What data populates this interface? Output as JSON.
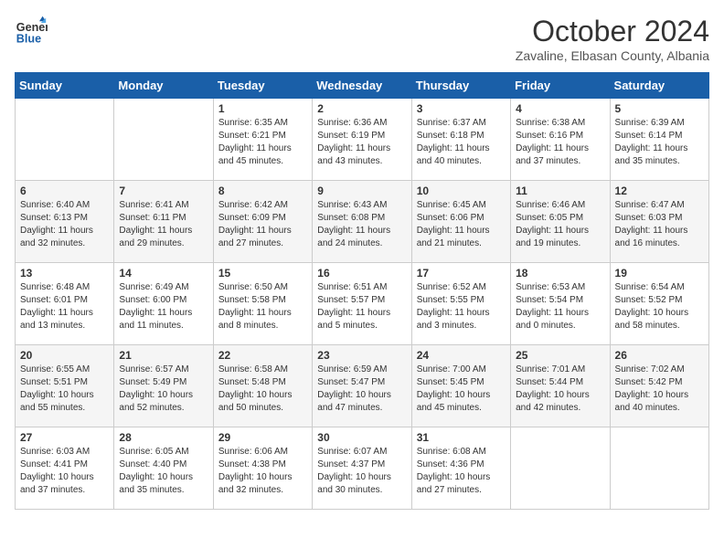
{
  "header": {
    "logo_line1": "General",
    "logo_line2": "Blue",
    "month_title": "October 2024",
    "subtitle": "Zavaline, Elbasan County, Albania"
  },
  "days_of_week": [
    "Sunday",
    "Monday",
    "Tuesday",
    "Wednesday",
    "Thursday",
    "Friday",
    "Saturday"
  ],
  "weeks": [
    [
      {
        "num": "",
        "sunrise": "",
        "sunset": "",
        "daylight": ""
      },
      {
        "num": "",
        "sunrise": "",
        "sunset": "",
        "daylight": ""
      },
      {
        "num": "1",
        "sunrise": "Sunrise: 6:35 AM",
        "sunset": "Sunset: 6:21 PM",
        "daylight": "Daylight: 11 hours and 45 minutes."
      },
      {
        "num": "2",
        "sunrise": "Sunrise: 6:36 AM",
        "sunset": "Sunset: 6:19 PM",
        "daylight": "Daylight: 11 hours and 43 minutes."
      },
      {
        "num": "3",
        "sunrise": "Sunrise: 6:37 AM",
        "sunset": "Sunset: 6:18 PM",
        "daylight": "Daylight: 11 hours and 40 minutes."
      },
      {
        "num": "4",
        "sunrise": "Sunrise: 6:38 AM",
        "sunset": "Sunset: 6:16 PM",
        "daylight": "Daylight: 11 hours and 37 minutes."
      },
      {
        "num": "5",
        "sunrise": "Sunrise: 6:39 AM",
        "sunset": "Sunset: 6:14 PM",
        "daylight": "Daylight: 11 hours and 35 minutes."
      }
    ],
    [
      {
        "num": "6",
        "sunrise": "Sunrise: 6:40 AM",
        "sunset": "Sunset: 6:13 PM",
        "daylight": "Daylight: 11 hours and 32 minutes."
      },
      {
        "num": "7",
        "sunrise": "Sunrise: 6:41 AM",
        "sunset": "Sunset: 6:11 PM",
        "daylight": "Daylight: 11 hours and 29 minutes."
      },
      {
        "num": "8",
        "sunrise": "Sunrise: 6:42 AM",
        "sunset": "Sunset: 6:09 PM",
        "daylight": "Daylight: 11 hours and 27 minutes."
      },
      {
        "num": "9",
        "sunrise": "Sunrise: 6:43 AM",
        "sunset": "Sunset: 6:08 PM",
        "daylight": "Daylight: 11 hours and 24 minutes."
      },
      {
        "num": "10",
        "sunrise": "Sunrise: 6:45 AM",
        "sunset": "Sunset: 6:06 PM",
        "daylight": "Daylight: 11 hours and 21 minutes."
      },
      {
        "num": "11",
        "sunrise": "Sunrise: 6:46 AM",
        "sunset": "Sunset: 6:05 PM",
        "daylight": "Daylight: 11 hours and 19 minutes."
      },
      {
        "num": "12",
        "sunrise": "Sunrise: 6:47 AM",
        "sunset": "Sunset: 6:03 PM",
        "daylight": "Daylight: 11 hours and 16 minutes."
      }
    ],
    [
      {
        "num": "13",
        "sunrise": "Sunrise: 6:48 AM",
        "sunset": "Sunset: 6:01 PM",
        "daylight": "Daylight: 11 hours and 13 minutes."
      },
      {
        "num": "14",
        "sunrise": "Sunrise: 6:49 AM",
        "sunset": "Sunset: 6:00 PM",
        "daylight": "Daylight: 11 hours and 11 minutes."
      },
      {
        "num": "15",
        "sunrise": "Sunrise: 6:50 AM",
        "sunset": "Sunset: 5:58 PM",
        "daylight": "Daylight: 11 hours and 8 minutes."
      },
      {
        "num": "16",
        "sunrise": "Sunrise: 6:51 AM",
        "sunset": "Sunset: 5:57 PM",
        "daylight": "Daylight: 11 hours and 5 minutes."
      },
      {
        "num": "17",
        "sunrise": "Sunrise: 6:52 AM",
        "sunset": "Sunset: 5:55 PM",
        "daylight": "Daylight: 11 hours and 3 minutes."
      },
      {
        "num": "18",
        "sunrise": "Sunrise: 6:53 AM",
        "sunset": "Sunset: 5:54 PM",
        "daylight": "Daylight: 11 hours and 0 minutes."
      },
      {
        "num": "19",
        "sunrise": "Sunrise: 6:54 AM",
        "sunset": "Sunset: 5:52 PM",
        "daylight": "Daylight: 10 hours and 58 minutes."
      }
    ],
    [
      {
        "num": "20",
        "sunrise": "Sunrise: 6:55 AM",
        "sunset": "Sunset: 5:51 PM",
        "daylight": "Daylight: 10 hours and 55 minutes."
      },
      {
        "num": "21",
        "sunrise": "Sunrise: 6:57 AM",
        "sunset": "Sunset: 5:49 PM",
        "daylight": "Daylight: 10 hours and 52 minutes."
      },
      {
        "num": "22",
        "sunrise": "Sunrise: 6:58 AM",
        "sunset": "Sunset: 5:48 PM",
        "daylight": "Daylight: 10 hours and 50 minutes."
      },
      {
        "num": "23",
        "sunrise": "Sunrise: 6:59 AM",
        "sunset": "Sunset: 5:47 PM",
        "daylight": "Daylight: 10 hours and 47 minutes."
      },
      {
        "num": "24",
        "sunrise": "Sunrise: 7:00 AM",
        "sunset": "Sunset: 5:45 PM",
        "daylight": "Daylight: 10 hours and 45 minutes."
      },
      {
        "num": "25",
        "sunrise": "Sunrise: 7:01 AM",
        "sunset": "Sunset: 5:44 PM",
        "daylight": "Daylight: 10 hours and 42 minutes."
      },
      {
        "num": "26",
        "sunrise": "Sunrise: 7:02 AM",
        "sunset": "Sunset: 5:42 PM",
        "daylight": "Daylight: 10 hours and 40 minutes."
      }
    ],
    [
      {
        "num": "27",
        "sunrise": "Sunrise: 6:03 AM",
        "sunset": "Sunset: 4:41 PM",
        "daylight": "Daylight: 10 hours and 37 minutes."
      },
      {
        "num": "28",
        "sunrise": "Sunrise: 6:05 AM",
        "sunset": "Sunset: 4:40 PM",
        "daylight": "Daylight: 10 hours and 35 minutes."
      },
      {
        "num": "29",
        "sunrise": "Sunrise: 6:06 AM",
        "sunset": "Sunset: 4:38 PM",
        "daylight": "Daylight: 10 hours and 32 minutes."
      },
      {
        "num": "30",
        "sunrise": "Sunrise: 6:07 AM",
        "sunset": "Sunset: 4:37 PM",
        "daylight": "Daylight: 10 hours and 30 minutes."
      },
      {
        "num": "31",
        "sunrise": "Sunrise: 6:08 AM",
        "sunset": "Sunset: 4:36 PM",
        "daylight": "Daylight: 10 hours and 27 minutes."
      },
      {
        "num": "",
        "sunrise": "",
        "sunset": "",
        "daylight": ""
      },
      {
        "num": "",
        "sunrise": "",
        "sunset": "",
        "daylight": ""
      }
    ]
  ]
}
